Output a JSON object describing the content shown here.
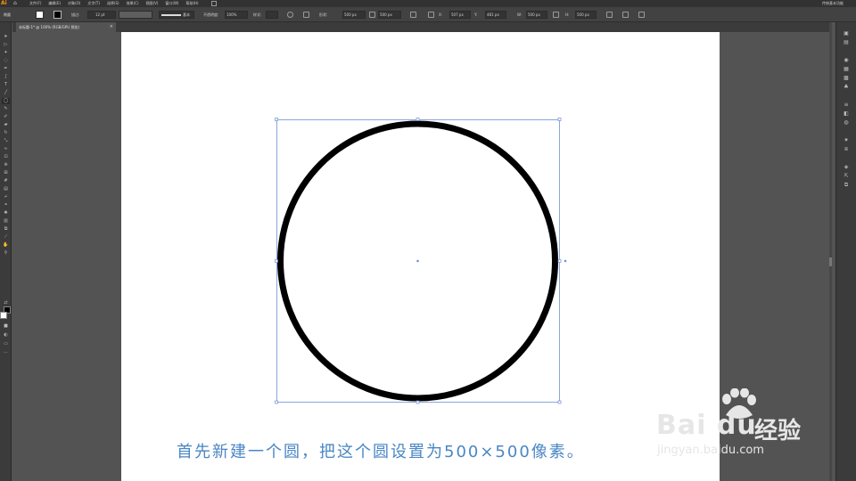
{
  "app": {
    "logo": "Ai",
    "workspace_label": "传统基本功能"
  },
  "menu": [
    "文件(F)",
    "编辑(E)",
    "对象(O)",
    "文字(T)",
    "选择(S)",
    "效果(C)",
    "视图(V)",
    "窗口(W)",
    "帮助(H)"
  ],
  "control_bar": {
    "selection_label": "椭圆",
    "stroke_label": "描边:",
    "stroke_weight": "12 pt",
    "stroke_style": "基本",
    "opacity_label": "不透明度:",
    "opacity_value": "100%",
    "style_label": "样式:",
    "shape_label": "形状:",
    "width_value": "500 px",
    "height_value": "500 px",
    "x_value": "507 px",
    "y_value": "481 px",
    "w_value": "500 px",
    "h_value": "500 px"
  },
  "document": {
    "tab_title": "未标题-1* @ 100% (RGB/GPU 预览)",
    "close_glyph": "×"
  },
  "colors": {
    "accent": "#4a86c4",
    "selection": "#6d8fd6",
    "ui_dark": "#323232",
    "pasteboard": "#535353"
  },
  "caption": "首先新建一个圆，把这个圆设置为500×500像素。",
  "watermark": {
    "brand": "Bai du",
    "brand_cn": "经验",
    "url": "jingyan.baidu.com"
  }
}
